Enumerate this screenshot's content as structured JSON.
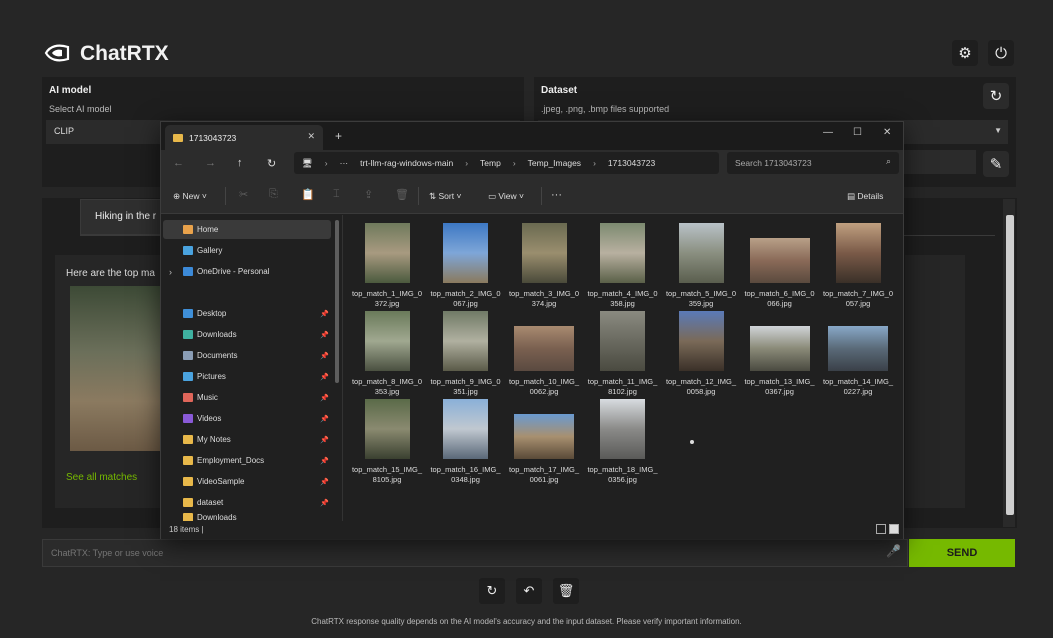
{
  "app": {
    "title": "ChatRTX"
  },
  "header": {
    "settings_icon": "gear-icon",
    "power_icon": "power-icon"
  },
  "ai_model": {
    "heading": "AI model",
    "select_label": "Select AI model",
    "value": "CLIP"
  },
  "dataset": {
    "heading": "Dataset",
    "supported": ".jpeg, .png, .bmp files supported"
  },
  "chat": {
    "user_message": "Hiking in the r",
    "bot_message": "Here are the top ma",
    "see_all": "See all matches",
    "input_placeholder": "ChatRTX: Type or use voice",
    "send_label": "SEND"
  },
  "footer": "ChatRTX response quality depends on the AI model's accuracy and the input dataset. Please verify important information.",
  "explorer": {
    "tab_title": "1713043723",
    "path": [
      "trt-llm-rag-windows-main",
      "Temp",
      "Temp_Images",
      "1713043723"
    ],
    "search_placeholder": "Search 1713043723",
    "toolbar": {
      "new": "New",
      "sort": "Sort",
      "view": "View",
      "details": "Details"
    },
    "nav": [
      {
        "label": "Home",
        "icon": "home-icon",
        "color": "#e9a24b"
      },
      {
        "label": "Gallery",
        "icon": "gallery-icon",
        "color": "#4aa3df"
      },
      {
        "label": "OneDrive - Personal",
        "icon": "onedrive-icon",
        "color": "#3c8ad8"
      },
      {
        "label": "Desktop",
        "icon": "desktop-icon",
        "color": "#3f8fd8"
      },
      {
        "label": "Downloads",
        "icon": "download-icon",
        "color": "#3fb1a0"
      },
      {
        "label": "Documents",
        "icon": "documents-icon",
        "color": "#8a9db5"
      },
      {
        "label": "Pictures",
        "icon": "pictures-icon",
        "color": "#4aa3df"
      },
      {
        "label": "Music",
        "icon": "music-icon",
        "color": "#e0665a"
      },
      {
        "label": "Videos",
        "icon": "videos-icon",
        "color": "#8a5ad8"
      },
      {
        "label": "My Notes",
        "icon": "folder-icon",
        "color": "#e8b84a"
      },
      {
        "label": "Employment_Docs",
        "icon": "folder-icon",
        "color": "#e8b84a"
      },
      {
        "label": "VideoSample",
        "icon": "folder-icon",
        "color": "#e8b84a"
      },
      {
        "label": "dataset",
        "icon": "folder-icon",
        "color": "#e8b84a"
      },
      {
        "label": "Downloads",
        "icon": "folder-icon",
        "color": "#e8b84a"
      }
    ],
    "files": [
      {
        "name": "top_match_1_IMG_0372.jpg",
        "shape": "portrait",
        "colors": [
          "#6f7a5c",
          "#a89a80",
          "#4b5a3e"
        ]
      },
      {
        "name": "top_match_2_IMG_0067.jpg",
        "shape": "portrait",
        "colors": [
          "#3d78c4",
          "#7ea6d8",
          "#8a7a5e"
        ]
      },
      {
        "name": "top_match_3_IMG_0374.jpg",
        "shape": "portrait",
        "colors": [
          "#6a6a50",
          "#9a8e6e",
          "#4a4a3a"
        ]
      },
      {
        "name": "top_match_4_IMG_0358.jpg",
        "shape": "portrait",
        "colors": [
          "#7c8a70",
          "#b8b0a0",
          "#5a6048"
        ]
      },
      {
        "name": "top_match_5_IMG_0359.jpg",
        "shape": "portrait",
        "colors": [
          "#b9c2c8",
          "#8a8f80",
          "#5a5e4e"
        ]
      },
      {
        "name": "top_match_6_IMG_0066.jpg",
        "shape": "landscape",
        "colors": [
          "#b8a088",
          "#8a6a58",
          "#5a4a3e"
        ]
      },
      {
        "name": "top_match_7_IMG_0057.jpg",
        "shape": "portrait",
        "colors": [
          "#c0a080",
          "#7a5a48",
          "#3a3028"
        ]
      },
      {
        "name": "top_match_8_IMG_0353.jpg",
        "shape": "portrait",
        "colors": [
          "#6a7a5a",
          "#a0a890",
          "#4a5040"
        ]
      },
      {
        "name": "top_match_9_IMG_0351.jpg",
        "shape": "portrait",
        "colors": [
          "#707a66",
          "#b0b0a0",
          "#5a5a48"
        ]
      },
      {
        "name": "top_match_10_IMG_0062.jpg",
        "shape": "landscape",
        "colors": [
          "#a88a70",
          "#7a6050",
          "#5a4a40"
        ]
      },
      {
        "name": "top_match_11_IMG_8102.jpg",
        "shape": "portrait",
        "colors": [
          "#8a8a80",
          "#6a6a60",
          "#4a4a40"
        ]
      },
      {
        "name": "top_match_12_IMG_0058.jpg",
        "shape": "portrait",
        "colors": [
          "#5a7ab8",
          "#7a6a58",
          "#3a3028"
        ]
      },
      {
        "name": "top_match_13_IMG_0367.jpg",
        "shape": "landscape",
        "colors": [
          "#d0d4d8",
          "#8a8a78",
          "#4a4a40"
        ]
      },
      {
        "name": "top_match_14_IMG_0227.jpg",
        "shape": "landscape",
        "colors": [
          "#88a8c8",
          "#5a6a78",
          "#3a4048"
        ]
      },
      {
        "name": "top_match_15_IMG_8105.jpg",
        "shape": "portrait",
        "colors": [
          "#5a6a48",
          "#8a8a70",
          "#3a4030"
        ]
      },
      {
        "name": "top_match_16_IMG_0348.jpg",
        "shape": "portrait",
        "colors": [
          "#8ab0d8",
          "#c0c8d0",
          "#5a6878"
        ]
      },
      {
        "name": "top_match_17_IMG_0061.jpg",
        "shape": "landscape",
        "colors": [
          "#6a9ad0",
          "#a89070",
          "#5a4a38"
        ]
      },
      {
        "name": "top_match_18_IMG_0356.jpg",
        "shape": "portrait",
        "colors": [
          "#d8dce0",
          "#8a8a88",
          "#5a5a58"
        ]
      }
    ],
    "item_count": "18 items"
  }
}
